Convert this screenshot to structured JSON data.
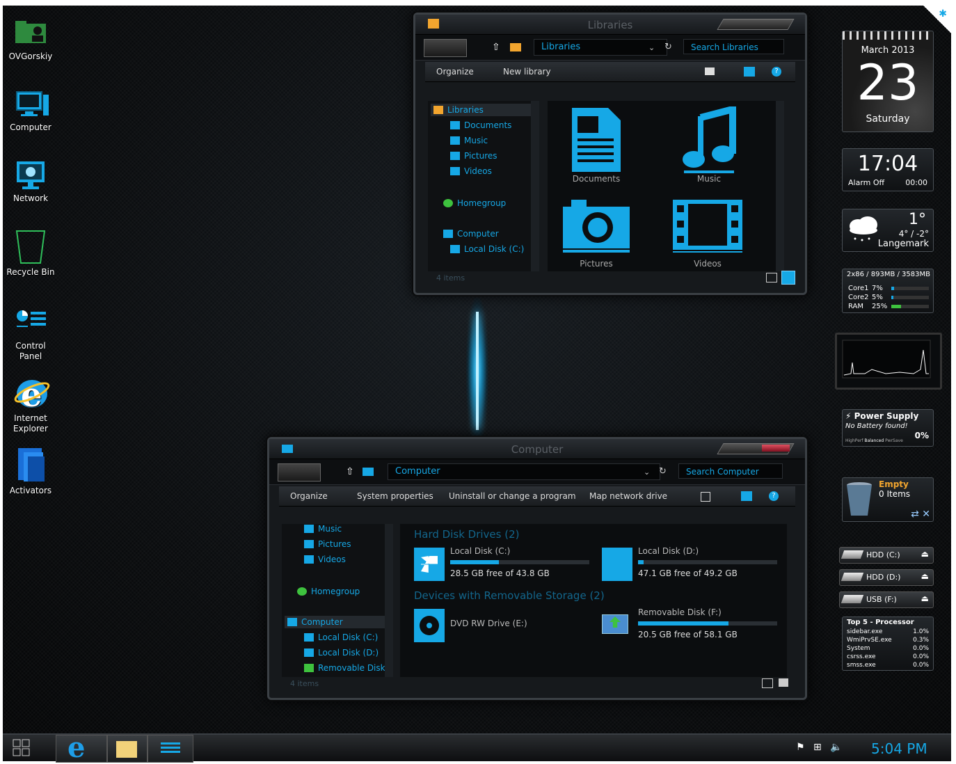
{
  "desktop_icons": [
    {
      "label": "OVGorskiy",
      "icon": "user-folder-icon"
    },
    {
      "label": "Computer",
      "icon": "computer-icon"
    },
    {
      "label": "Network",
      "icon": "network-icon"
    },
    {
      "label": "Recycle Bin",
      "icon": "recycle-bin-icon"
    },
    {
      "label": "Control Panel",
      "icon": "control-panel-icon"
    },
    {
      "label": "Internet Explorer",
      "icon": "internet-explorer-icon"
    },
    {
      "label": "Activators",
      "icon": "folder-icon"
    }
  ],
  "libraries_window": {
    "title": "Libraries",
    "address": "Libraries",
    "search_placeholder": "Search Libraries",
    "commands": {
      "organize": "Organize",
      "new_library": "New library"
    },
    "nav": {
      "libraries": "Libraries",
      "documents": "Documents",
      "music": "Music",
      "pictures": "Pictures",
      "videos": "Videos",
      "homegroup": "Homegroup",
      "computer": "Computer",
      "local_disk_c": "Local Disk (C:)"
    },
    "items": [
      {
        "label": "Documents",
        "icon": "document-icon"
      },
      {
        "label": "Music",
        "icon": "music-note-icon"
      },
      {
        "label": "Pictures",
        "icon": "camera-icon"
      },
      {
        "label": "Videos",
        "icon": "film-icon"
      }
    ],
    "status": "4 items"
  },
  "computer_window": {
    "title": "Computer",
    "address": "Computer",
    "search_placeholder": "Search Computer",
    "commands": {
      "organize": "Organize",
      "system_properties": "System properties",
      "uninstall": "Uninstall or change a program",
      "map_drive": "Map network drive"
    },
    "nav": {
      "music": "Music",
      "pictures": "Pictures",
      "videos": "Videos",
      "homegroup": "Homegroup",
      "computer": "Computer",
      "local_disk_c": "Local Disk (C:)",
      "local_disk_d": "Local Disk (D:)",
      "removable_disk": "Removable Disk ("
    },
    "groups": {
      "hdd": "Hard Disk Drives (2)",
      "removable": "Devices with Removable Storage (2)"
    },
    "drives": {
      "c": {
        "name": "Local Disk (C:)",
        "free": "28.5 GB free of 43.8 GB",
        "used_fraction": 0.35
      },
      "d": {
        "name": "Local Disk (D:)",
        "free": "47.1 GB free of 49.2 GB",
        "used_fraction": 0.04
      },
      "e": {
        "name": "DVD RW Drive (E:)"
      },
      "f": {
        "name": "Removable Disk (F:)",
        "free": "20.5 GB free of 58.1 GB",
        "used_fraction": 0.65
      }
    },
    "status": "4 items"
  },
  "gadgets": {
    "calendar": {
      "month_year": "March 2013",
      "day": "23",
      "weekday": "Saturday"
    },
    "clock": {
      "time": "17:04",
      "alarm": "Alarm Off",
      "alarm_time": "00:00"
    },
    "weather": {
      "temp": "1°",
      "range": "4° / -2°",
      "location": "Langemark"
    },
    "cpu": {
      "header": "2x86 / 893MB / 3583MB",
      "rows": [
        {
          "label": "Core1",
          "value": "7%",
          "fraction": 0.07
        },
        {
          "label": "Core2",
          "value": "5%",
          "fraction": 0.05
        },
        {
          "label": "RAM",
          "value": "25%",
          "fraction": 0.25
        }
      ]
    },
    "power": {
      "title": "Power Supply",
      "status": "No Battery found!",
      "modes": [
        "HighPerf",
        "Balanced",
        "PwrSave"
      ],
      "percent": "0%"
    },
    "recycle": {
      "state": "Empty",
      "count": "0 Items"
    },
    "drives": [
      {
        "label": "HDD (C:)"
      },
      {
        "label": "HDD (D:)"
      },
      {
        "label": "USB (F:)"
      }
    ],
    "top5": {
      "title": "Top 5 - Processor",
      "rows": [
        {
          "name": "sidebar.exe",
          "value": "1.0%"
        },
        {
          "name": "WmiPrvSE.exe",
          "value": "0.3%"
        },
        {
          "name": "System",
          "value": "0.0%"
        },
        {
          "name": "csrss.exe",
          "value": "0.0%"
        },
        {
          "name": "smss.exe",
          "value": "0.0%"
        }
      ]
    }
  },
  "taskbar": {
    "clock": "5:04 PM",
    "pinned": [
      {
        "icon": "start-icon"
      },
      {
        "icon": "internet-explorer-icon"
      },
      {
        "icon": "file-explorer-icon"
      },
      {
        "icon": "control-panel-icon"
      }
    ]
  },
  "colors": {
    "accent": "#16a8e6",
    "dark": "#0d0f11"
  }
}
